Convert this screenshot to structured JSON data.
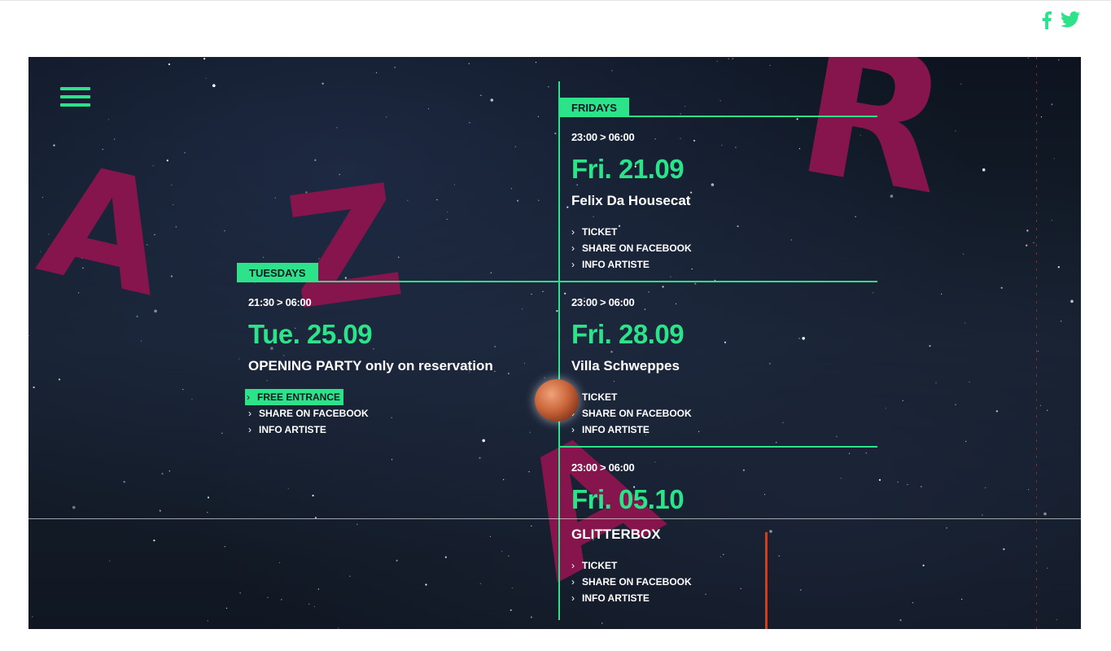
{
  "social": {
    "facebook_icon": "facebook-icon",
    "twitter_icon": "twitter-icon"
  },
  "nav": {
    "menu_icon": "hamburger-menu-icon"
  },
  "decor": {
    "letters": [
      "A",
      "Z",
      "R",
      "A"
    ],
    "letter_color": "#86154d"
  },
  "colors": {
    "accent": "#2de38a",
    "background": "#141d29"
  },
  "tuesdays": {
    "label": "TUESDAYS",
    "event": {
      "time": "21:30 > 06:00",
      "date": "Tue. 25.09",
      "artist": "OPENING PARTY only on reservation",
      "links": [
        "FREE ENTRANCE",
        "SHARE ON FACEBOOK",
        "INFO ARTISTE"
      ]
    }
  },
  "fridays": {
    "label": "FRIDAYS",
    "events": [
      {
        "time": "23:00 > 06:00",
        "date": "Fri. 21.09",
        "artist": "Felix Da Housecat",
        "links": [
          "TICKET",
          "SHARE ON FACEBOOK",
          "INFO ARTISTE"
        ]
      },
      {
        "time": "23:00 > 06:00",
        "date": "Fri. 28.09",
        "artist": "Villa Schweppes",
        "links": [
          "TICKET",
          "SHARE ON FACEBOOK",
          "INFO ARTISTE"
        ]
      },
      {
        "time": "23:00 > 06:00",
        "date": "Fri. 05.10",
        "artist": "GLITTERBOX",
        "links": [
          "TICKET",
          "SHARE ON FACEBOOK",
          "INFO ARTISTE"
        ]
      }
    ]
  }
}
